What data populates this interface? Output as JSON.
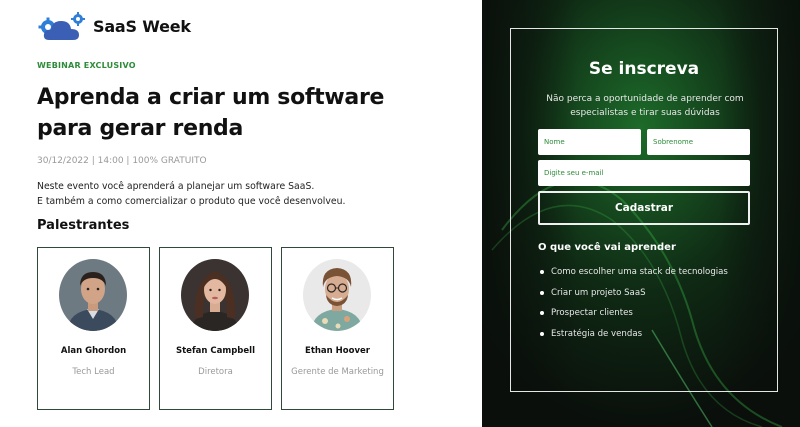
{
  "brand": {
    "name": "SaaS Week",
    "logo_icon": "cloud-gear-icon"
  },
  "hero": {
    "eyebrow": "WEBINAR EXCLUSIVO",
    "headline": "Aprenda a criar um software para gerar renda",
    "meta": "30/12/2022 | 14:00 | 100% GRATUITO",
    "description_line1": "Neste evento você aprenderá a planejar um software SaaS.",
    "description_line2": "E também a como comercializar o produto que você desenvolveu."
  },
  "speakers": {
    "title": "Palestrantes",
    "items": [
      {
        "name": "Alan Ghordon",
        "role": "Tech Lead"
      },
      {
        "name": "Stefan Campbell",
        "role": "Diretora"
      },
      {
        "name": "Ethan Hoover",
        "role": "Gerente de Marketing"
      }
    ]
  },
  "signup": {
    "title": "Se inscreva",
    "subtitle": "Não perca a oportunidade de aprender com especialistas e tirar suas dúvidas",
    "first_name_placeholder": "Nome",
    "last_name_placeholder": "Sobrenome",
    "email_placeholder": "Digite seu e-mail",
    "submit_label": "Cadastrar"
  },
  "learn": {
    "title": "O que você vai aprender",
    "items": [
      "Como escolher uma stack de tecnologias",
      "Criar um projeto SaaS",
      "Prospectar clientes",
      "Estratégia de vendas"
    ]
  },
  "colors": {
    "accent_green": "#2e8b3a",
    "dark_panel": "#0e140f",
    "card_border": "#2f4a3a",
    "logo_blue": "#3a5fb5"
  }
}
